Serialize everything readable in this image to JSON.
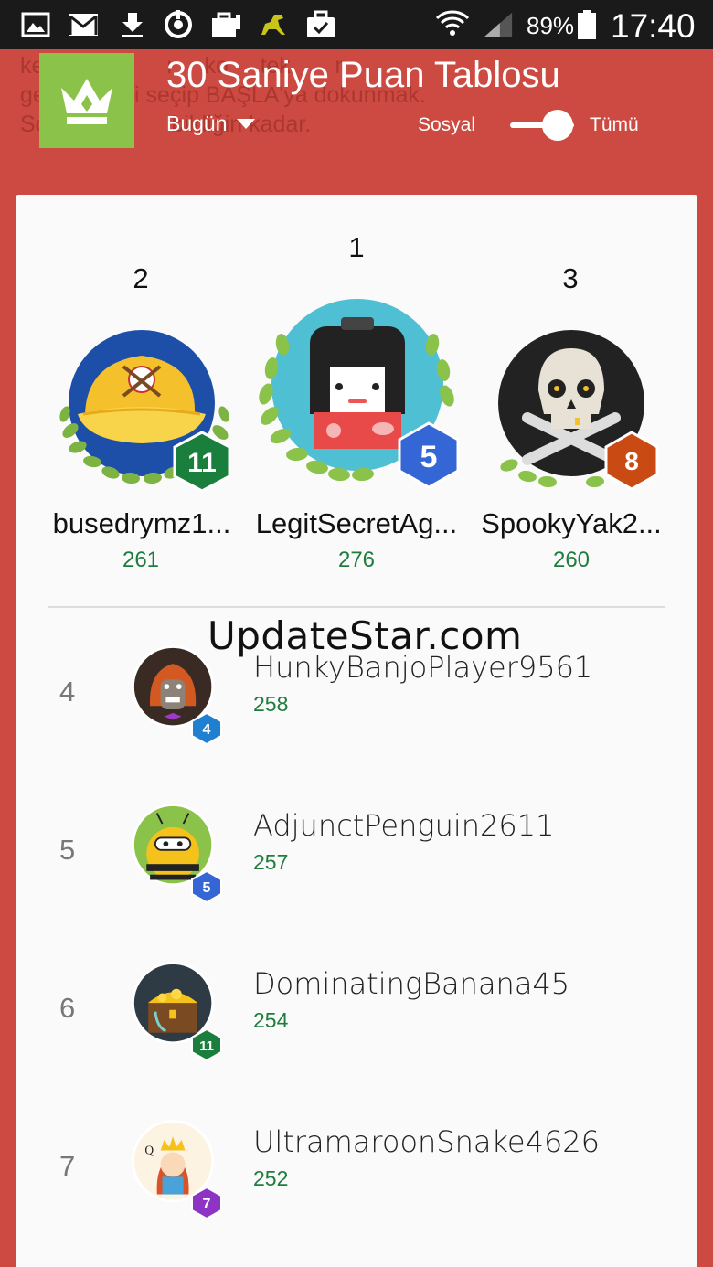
{
  "status_bar": {
    "battery_pct": "89%",
    "time": "17:40",
    "icons": [
      "gallery-icon",
      "gmail-icon",
      "download-icon",
      "sync-icon",
      "briefcase-icon",
      "game-icon",
      "work-bag-icon",
      "wifi-icon",
      "signal-icon",
      "battery-icon"
    ]
  },
  "background_text": "ke       ır h       ı     ko     tek       n\nge         reyi seçip BAŞLA'ya dokunmak.\nSo       sall       bildiğin kadar.",
  "header": {
    "title": "30 Saniye Puan Tablosu",
    "period": "Bugün",
    "social_label": "Sosyal",
    "all_label": "Tümü",
    "toggle_on": true
  },
  "podium": [
    {
      "rank": "2",
      "name": "busedrymz1...",
      "score": "261",
      "level": "11",
      "badge_color": "#1a7f3c",
      "avatar": "baseball-cap-avatar"
    },
    {
      "rank": "1",
      "name": "LegitSecretAg...",
      "score": "276",
      "level": "5",
      "badge_color": "#3566d6",
      "avatar": "kokeshi-doll-avatar"
    },
    {
      "rank": "3",
      "name": "SpookyYak2...",
      "score": "260",
      "level": "8",
      "badge_color": "#c94a12",
      "avatar": "skull-avatar"
    }
  ],
  "watermark": "UpdateStar.com",
  "rows": [
    {
      "rank": "4",
      "name": "HunkyBanjoPlayer9561",
      "score": "258",
      "level": "4",
      "badge_color": "#1f7fd0",
      "avatar": "werewolf-avatar"
    },
    {
      "rank": "5",
      "name": "AdjunctPenguin2611",
      "score": "257",
      "level": "5",
      "badge_color": "#3566d6",
      "avatar": "bee-avatar"
    },
    {
      "rank": "6",
      "name": "DominatingBanana45",
      "score": "254",
      "level": "11",
      "badge_color": "#1a7f3c",
      "avatar": "treasure-chest-avatar"
    },
    {
      "rank": "7",
      "name": "UltramaroonSnake4626",
      "score": "252",
      "level": "7",
      "badge_color": "#8e34c4",
      "avatar": "queen-card-avatar"
    }
  ]
}
